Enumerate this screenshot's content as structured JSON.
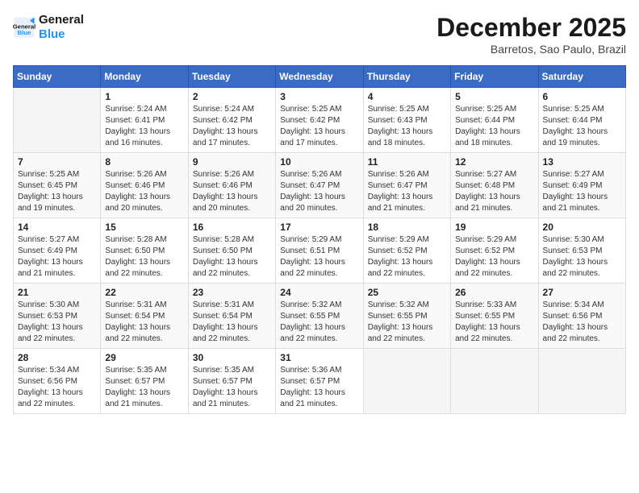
{
  "logo": {
    "line1": "General",
    "line2": "Blue"
  },
  "title": "December 2025",
  "location": "Barretos, Sao Paulo, Brazil",
  "weekdays": [
    "Sunday",
    "Monday",
    "Tuesday",
    "Wednesday",
    "Thursday",
    "Friday",
    "Saturday"
  ],
  "weeks": [
    [
      {
        "day": "",
        "sunrise": "",
        "sunset": "",
        "daylight": ""
      },
      {
        "day": "1",
        "sunrise": "Sunrise: 5:24 AM",
        "sunset": "Sunset: 6:41 PM",
        "daylight": "Daylight: 13 hours and 16 minutes."
      },
      {
        "day": "2",
        "sunrise": "Sunrise: 5:24 AM",
        "sunset": "Sunset: 6:42 PM",
        "daylight": "Daylight: 13 hours and 17 minutes."
      },
      {
        "day": "3",
        "sunrise": "Sunrise: 5:25 AM",
        "sunset": "Sunset: 6:42 PM",
        "daylight": "Daylight: 13 hours and 17 minutes."
      },
      {
        "day": "4",
        "sunrise": "Sunrise: 5:25 AM",
        "sunset": "Sunset: 6:43 PM",
        "daylight": "Daylight: 13 hours and 18 minutes."
      },
      {
        "day": "5",
        "sunrise": "Sunrise: 5:25 AM",
        "sunset": "Sunset: 6:44 PM",
        "daylight": "Daylight: 13 hours and 18 minutes."
      },
      {
        "day": "6",
        "sunrise": "Sunrise: 5:25 AM",
        "sunset": "Sunset: 6:44 PM",
        "daylight": "Daylight: 13 hours and 19 minutes."
      }
    ],
    [
      {
        "day": "7",
        "sunrise": "Sunrise: 5:25 AM",
        "sunset": "Sunset: 6:45 PM",
        "daylight": "Daylight: 13 hours and 19 minutes."
      },
      {
        "day": "8",
        "sunrise": "Sunrise: 5:26 AM",
        "sunset": "Sunset: 6:46 PM",
        "daylight": "Daylight: 13 hours and 20 minutes."
      },
      {
        "day": "9",
        "sunrise": "Sunrise: 5:26 AM",
        "sunset": "Sunset: 6:46 PM",
        "daylight": "Daylight: 13 hours and 20 minutes."
      },
      {
        "day": "10",
        "sunrise": "Sunrise: 5:26 AM",
        "sunset": "Sunset: 6:47 PM",
        "daylight": "Daylight: 13 hours and 20 minutes."
      },
      {
        "day": "11",
        "sunrise": "Sunrise: 5:26 AM",
        "sunset": "Sunset: 6:47 PM",
        "daylight": "Daylight: 13 hours and 21 minutes."
      },
      {
        "day": "12",
        "sunrise": "Sunrise: 5:27 AM",
        "sunset": "Sunset: 6:48 PM",
        "daylight": "Daylight: 13 hours and 21 minutes."
      },
      {
        "day": "13",
        "sunrise": "Sunrise: 5:27 AM",
        "sunset": "Sunset: 6:49 PM",
        "daylight": "Daylight: 13 hours and 21 minutes."
      }
    ],
    [
      {
        "day": "14",
        "sunrise": "Sunrise: 5:27 AM",
        "sunset": "Sunset: 6:49 PM",
        "daylight": "Daylight: 13 hours and 21 minutes."
      },
      {
        "day": "15",
        "sunrise": "Sunrise: 5:28 AM",
        "sunset": "Sunset: 6:50 PM",
        "daylight": "Daylight: 13 hours and 22 minutes."
      },
      {
        "day": "16",
        "sunrise": "Sunrise: 5:28 AM",
        "sunset": "Sunset: 6:50 PM",
        "daylight": "Daylight: 13 hours and 22 minutes."
      },
      {
        "day": "17",
        "sunrise": "Sunrise: 5:29 AM",
        "sunset": "Sunset: 6:51 PM",
        "daylight": "Daylight: 13 hours and 22 minutes."
      },
      {
        "day": "18",
        "sunrise": "Sunrise: 5:29 AM",
        "sunset": "Sunset: 6:52 PM",
        "daylight": "Daylight: 13 hours and 22 minutes."
      },
      {
        "day": "19",
        "sunrise": "Sunrise: 5:29 AM",
        "sunset": "Sunset: 6:52 PM",
        "daylight": "Daylight: 13 hours and 22 minutes."
      },
      {
        "day": "20",
        "sunrise": "Sunrise: 5:30 AM",
        "sunset": "Sunset: 6:53 PM",
        "daylight": "Daylight: 13 hours and 22 minutes."
      }
    ],
    [
      {
        "day": "21",
        "sunrise": "Sunrise: 5:30 AM",
        "sunset": "Sunset: 6:53 PM",
        "daylight": "Daylight: 13 hours and 22 minutes."
      },
      {
        "day": "22",
        "sunrise": "Sunrise: 5:31 AM",
        "sunset": "Sunset: 6:54 PM",
        "daylight": "Daylight: 13 hours and 22 minutes."
      },
      {
        "day": "23",
        "sunrise": "Sunrise: 5:31 AM",
        "sunset": "Sunset: 6:54 PM",
        "daylight": "Daylight: 13 hours and 22 minutes."
      },
      {
        "day": "24",
        "sunrise": "Sunrise: 5:32 AM",
        "sunset": "Sunset: 6:55 PM",
        "daylight": "Daylight: 13 hours and 22 minutes."
      },
      {
        "day": "25",
        "sunrise": "Sunrise: 5:32 AM",
        "sunset": "Sunset: 6:55 PM",
        "daylight": "Daylight: 13 hours and 22 minutes."
      },
      {
        "day": "26",
        "sunrise": "Sunrise: 5:33 AM",
        "sunset": "Sunset: 6:55 PM",
        "daylight": "Daylight: 13 hours and 22 minutes."
      },
      {
        "day": "27",
        "sunrise": "Sunrise: 5:34 AM",
        "sunset": "Sunset: 6:56 PM",
        "daylight": "Daylight: 13 hours and 22 minutes."
      }
    ],
    [
      {
        "day": "28",
        "sunrise": "Sunrise: 5:34 AM",
        "sunset": "Sunset: 6:56 PM",
        "daylight": "Daylight: 13 hours and 22 minutes."
      },
      {
        "day": "29",
        "sunrise": "Sunrise: 5:35 AM",
        "sunset": "Sunset: 6:57 PM",
        "daylight": "Daylight: 13 hours and 21 minutes."
      },
      {
        "day": "30",
        "sunrise": "Sunrise: 5:35 AM",
        "sunset": "Sunset: 6:57 PM",
        "daylight": "Daylight: 13 hours and 21 minutes."
      },
      {
        "day": "31",
        "sunrise": "Sunrise: 5:36 AM",
        "sunset": "Sunset: 6:57 PM",
        "daylight": "Daylight: 13 hours and 21 minutes."
      },
      {
        "day": "",
        "sunrise": "",
        "sunset": "",
        "daylight": ""
      },
      {
        "day": "",
        "sunrise": "",
        "sunset": "",
        "daylight": ""
      },
      {
        "day": "",
        "sunrise": "",
        "sunset": "",
        "daylight": ""
      }
    ]
  ]
}
